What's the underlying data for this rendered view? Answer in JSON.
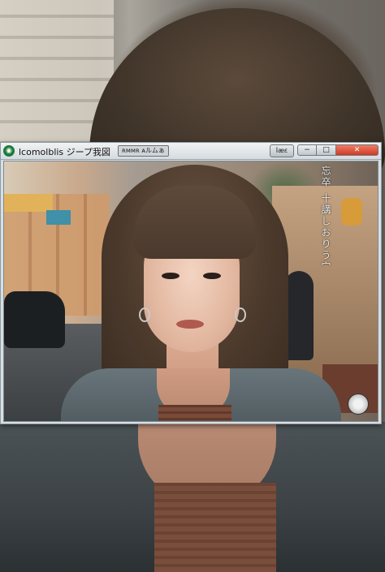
{
  "window": {
    "title": "lcomolblis ジープ我図",
    "tab_chip": "ʀᴍᴍʀ ᴀルムぁ",
    "tool_button": "İæε",
    "controls": {
      "minimize": "−",
      "maximize": "□",
      "close": "✕"
    },
    "accent_close": "#d9492f"
  },
  "overlay": {
    "vertical_text": "忘卒 十講しおりう宀"
  },
  "icons": {
    "app": "globe-icon",
    "seal": "seal-icon"
  }
}
